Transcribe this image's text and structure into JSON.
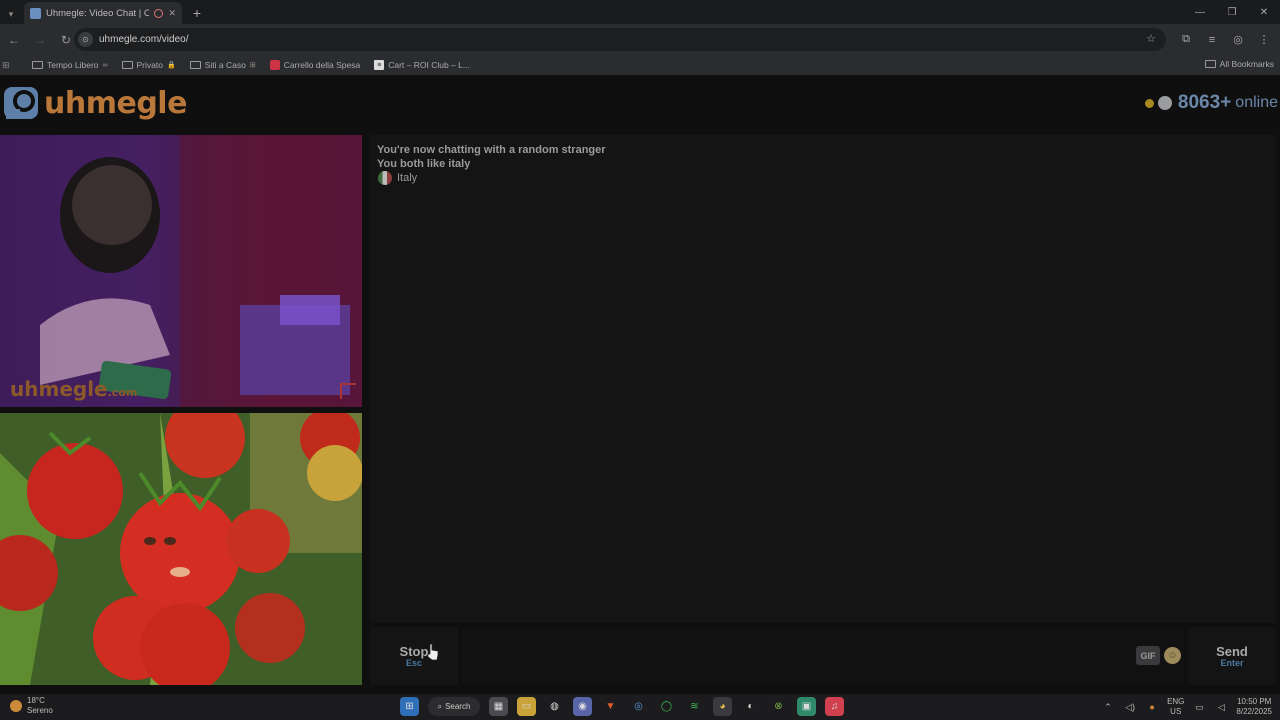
{
  "browser": {
    "tab_title": "Uhmegle: Video Chat | Ome",
    "url": "uhmegle.com/video/",
    "bookmarks": [
      {
        "label": "Tempo Libero",
        "type": "folder",
        "tag": "∞"
      },
      {
        "label": "Privato",
        "type": "folder",
        "tag": "🔒"
      },
      {
        "label": "Siti a Caso",
        "type": "folder",
        "tag": "⊞"
      },
      {
        "label": "Carrello della Spesa",
        "type": "red"
      },
      {
        "label": "Cart – ROI Club – L...",
        "type": "black"
      }
    ],
    "all_bookmarks_label": "All Bookmarks"
  },
  "header": {
    "logo_text": "uhmegle",
    "online_count": "8063+",
    "online_label": "online"
  },
  "videos": {
    "watermark": "uhmegle",
    "watermark_suffix": ".com"
  },
  "chat": {
    "status_line": "You're now chatting with a random stranger",
    "interest_line": "You both like italy",
    "country": "Italy"
  },
  "controls": {
    "stop_label": "Stop",
    "stop_shortcut": "Esc",
    "gif_label": "GIF",
    "send_label": "Send",
    "send_shortcut": "Enter"
  },
  "taskbar": {
    "temperature": "18°C",
    "condition": "Sereno",
    "search_label": "Search",
    "lang": "ENG",
    "region": "US",
    "time": "10:50 PM",
    "date": "8/22/2025"
  },
  "colors": {
    "logo_orange": "#b9773a",
    "online_blue": "#6b87a8",
    "shortcut_blue": "#4a78a0"
  }
}
